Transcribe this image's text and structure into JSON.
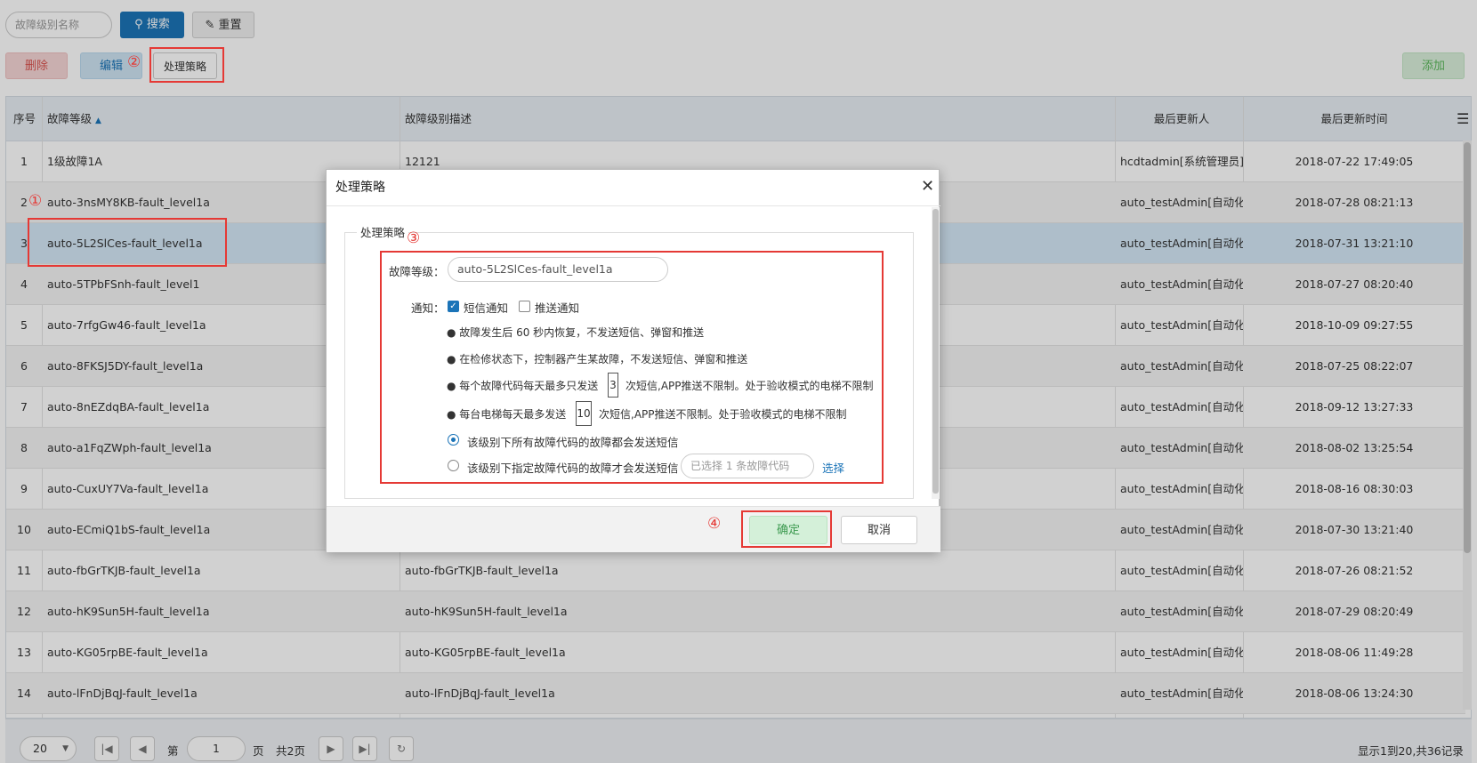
{
  "toolbar": {
    "search_placeholder": "故障级别名称",
    "search_label": "搜索",
    "reset_label": "重置",
    "delete_label": "删除",
    "edit_label": "编辑",
    "strategy_label": "处理策略",
    "add_label": "添加"
  },
  "table": {
    "headers": {
      "idx": "序号",
      "level": "故障等级",
      "desc": "故障级别描述",
      "user": "最后更新人",
      "time": "最后更新时间"
    },
    "rows": [
      {
        "idx": "1",
        "level": "1级故障1A",
        "desc": "12121",
        "user": "hcdtadmin[系统管理员]",
        "time": "2018-07-22 17:49:05"
      },
      {
        "idx": "2",
        "level": "auto-3nsMY8KB-fault_level1a",
        "desc": "",
        "user": "auto_testAdmin[自动化测",
        "time": "2018-07-28 08:21:13"
      },
      {
        "idx": "3",
        "level": "auto-5L2SlCes-fault_level1a",
        "desc": "",
        "user": "auto_testAdmin[自动化测",
        "time": "2018-07-31 13:21:10"
      },
      {
        "idx": "4",
        "level": "auto-5TPbFSnh-fault_level1",
        "desc": "",
        "user": "auto_testAdmin[自动化测",
        "time": "2018-07-27 08:20:40"
      },
      {
        "idx": "5",
        "level": "auto-7rfgGw46-fault_level1a",
        "desc": "",
        "user": "auto_testAdmin[自动化测",
        "time": "2018-10-09 09:27:55"
      },
      {
        "idx": "6",
        "level": "auto-8FKSJ5DY-fault_level1a",
        "desc": "",
        "user": "auto_testAdmin[自动化测",
        "time": "2018-07-25 08:22:07"
      },
      {
        "idx": "7",
        "level": "auto-8nEZdqBA-fault_level1a",
        "desc": "",
        "user": "auto_testAdmin[自动化测",
        "time": "2018-09-12 13:27:33"
      },
      {
        "idx": "8",
        "level": "auto-a1FqZWph-fault_level1a",
        "desc": "",
        "user": "auto_testAdmin[自动化测",
        "time": "2018-08-02 13:25:54"
      },
      {
        "idx": "9",
        "level": "auto-CuxUY7Va-fault_level1a",
        "desc": "",
        "user": "auto_testAdmin[自动化测",
        "time": "2018-08-16 08:30:03"
      },
      {
        "idx": "10",
        "level": "auto-ECmiQ1bS-fault_level1a",
        "desc": "",
        "user": "auto_testAdmin[自动化测",
        "time": "2018-07-30 13:21:40"
      },
      {
        "idx": "11",
        "level": "auto-fbGrTKJB-fault_level1a",
        "desc": "auto-fbGrTKJB-fault_level1a",
        "user": "auto_testAdmin[自动化测",
        "time": "2018-07-26 08:21:52"
      },
      {
        "idx": "12",
        "level": "auto-hK9Sun5H-fault_level1a",
        "desc": "auto-hK9Sun5H-fault_level1a",
        "user": "auto_testAdmin[自动化测",
        "time": "2018-07-29 08:20:49"
      },
      {
        "idx": "13",
        "level": "auto-KG05rpBE-fault_level1a",
        "desc": "auto-KG05rpBE-fault_level1a",
        "user": "auto_testAdmin[自动化测",
        "time": "2018-08-06 11:49:28"
      },
      {
        "idx": "14",
        "level": "auto-lFnDjBqJ-fault_level1a",
        "desc": "auto-lFnDjBqJ-fault_level1a",
        "user": "auto_testAdmin[自动化测",
        "time": "2018-08-06 13:24:30"
      }
    ]
  },
  "pager": {
    "page_size": "20",
    "page_prefix": "第",
    "page_value": "1",
    "page_suffix": "页",
    "total_pages": "共2页",
    "summary": "显示1到20,共36记录"
  },
  "dialog": {
    "title": "处理策略",
    "legend": "处理策略",
    "level_label": "故障等级：",
    "level_value": "auto-5L2SlCes-fault_level1a",
    "notify_label": "通知：",
    "sms_label": "短信通知",
    "push_label": "推送通知",
    "rule1": "● 故障发生后 60 秒内恢复，不发送短信、弹窗和推送",
    "rule2": "● 在检修状态下，控制器产生某故障，不发送短信、弹窗和推送",
    "rule3_pre": "● 每个故障代码每天最多只发送",
    "rule3_value": "3",
    "rule3_post": "次短信,APP推送不限制。处于验收模式的电梯不限制",
    "rule4_pre": "● 每台电梯每天最多发送",
    "rule4_value": "10",
    "rule4_post": "次短信,APP推送不限制。处于验收模式的电梯不限制",
    "radio1": "该级别下所有故障代码的故障都会发送短信",
    "radio2": "该级别下指定故障代码的故障才会发送短信",
    "selected_codes": "已选择 1 条故障代码",
    "select_link": "选择",
    "ok_label": "确定",
    "cancel_label": "取消"
  },
  "annotations": {
    "m1": "①",
    "m2": "②",
    "m3": "③",
    "m4": "④"
  },
  "colors": {
    "primary": "#1b74b8",
    "annotation_red": "#e53935",
    "selected_row": "#d5e8f7"
  }
}
